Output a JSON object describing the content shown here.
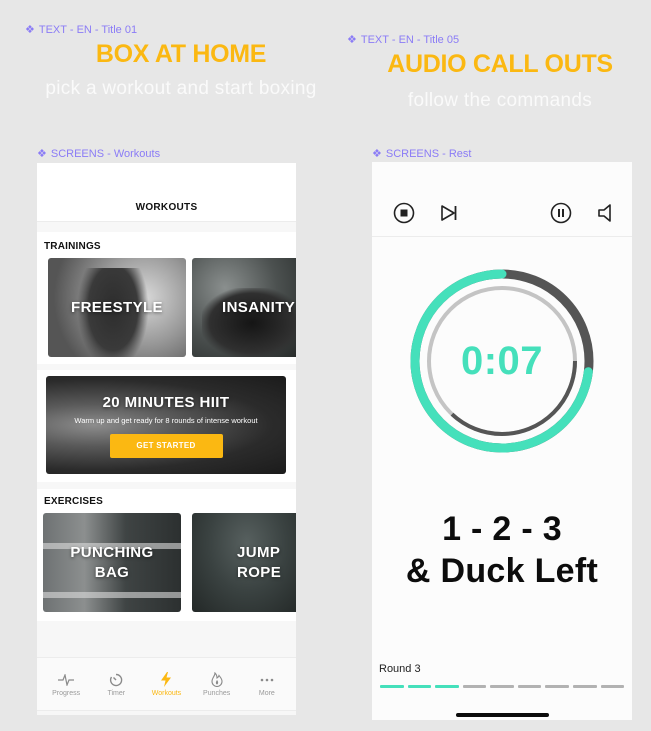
{
  "annotations": {
    "left_title": "TEXT - EN - Title 01",
    "right_title": "TEXT - EN - Title 05",
    "left_screen": "SCREENS - Workouts",
    "right_screen": "SCREENS - Rest",
    "icon": "component-diamond-icon"
  },
  "left_panel": {
    "title": "BOX AT HOME",
    "subtitle": "pick a workout and start boxing"
  },
  "right_panel": {
    "title": "AUDIO CALL OUTS",
    "subtitle": "follow the commands"
  },
  "workouts_screen": {
    "header": "WORKOUTS",
    "trainings_label": "TRAININGS",
    "trainings": [
      {
        "label": "FREESTYLE"
      },
      {
        "label": "INSANITY"
      }
    ],
    "featured": {
      "title": "20 MINUTES HIIT",
      "description": "Warm up and get ready for 8 rounds of intense workout",
      "button": "GET STARTED"
    },
    "exercises_label": "EXERCISES",
    "exercises": [
      {
        "line1": "PUNCHING",
        "line2": "BAG"
      },
      {
        "line1": "JUMP",
        "line2": "ROPE"
      }
    ],
    "tabbar": [
      {
        "label": "Progress",
        "icon": "pulse-icon",
        "active": false
      },
      {
        "label": "Timer",
        "icon": "timer-icon",
        "active": false
      },
      {
        "label": "Workouts",
        "icon": "lightning-icon",
        "active": true
      },
      {
        "label": "Punches",
        "icon": "flame-icon",
        "active": false
      },
      {
        "label": "More",
        "icon": "more-dots-icon",
        "active": false
      }
    ]
  },
  "rest_screen": {
    "controls": [
      "stop-icon",
      "skip-icon",
      "pause-icon",
      "volume-icon"
    ],
    "timer": "0:07",
    "outer_progress": 0.73,
    "inner_progress": 0.37,
    "callout_line1": "1 - 2 - 3",
    "callout_line2": "& Duck Left",
    "round_label": "Round 3",
    "rounds_total": 9,
    "rounds_done": 3
  },
  "colors": {
    "accent_yellow": "#fbb812",
    "accent_teal": "#45e0bb",
    "annotation_purple": "#8b7cf6",
    "ring_dark": "#555555",
    "ring_light": "#c4c4c4"
  }
}
